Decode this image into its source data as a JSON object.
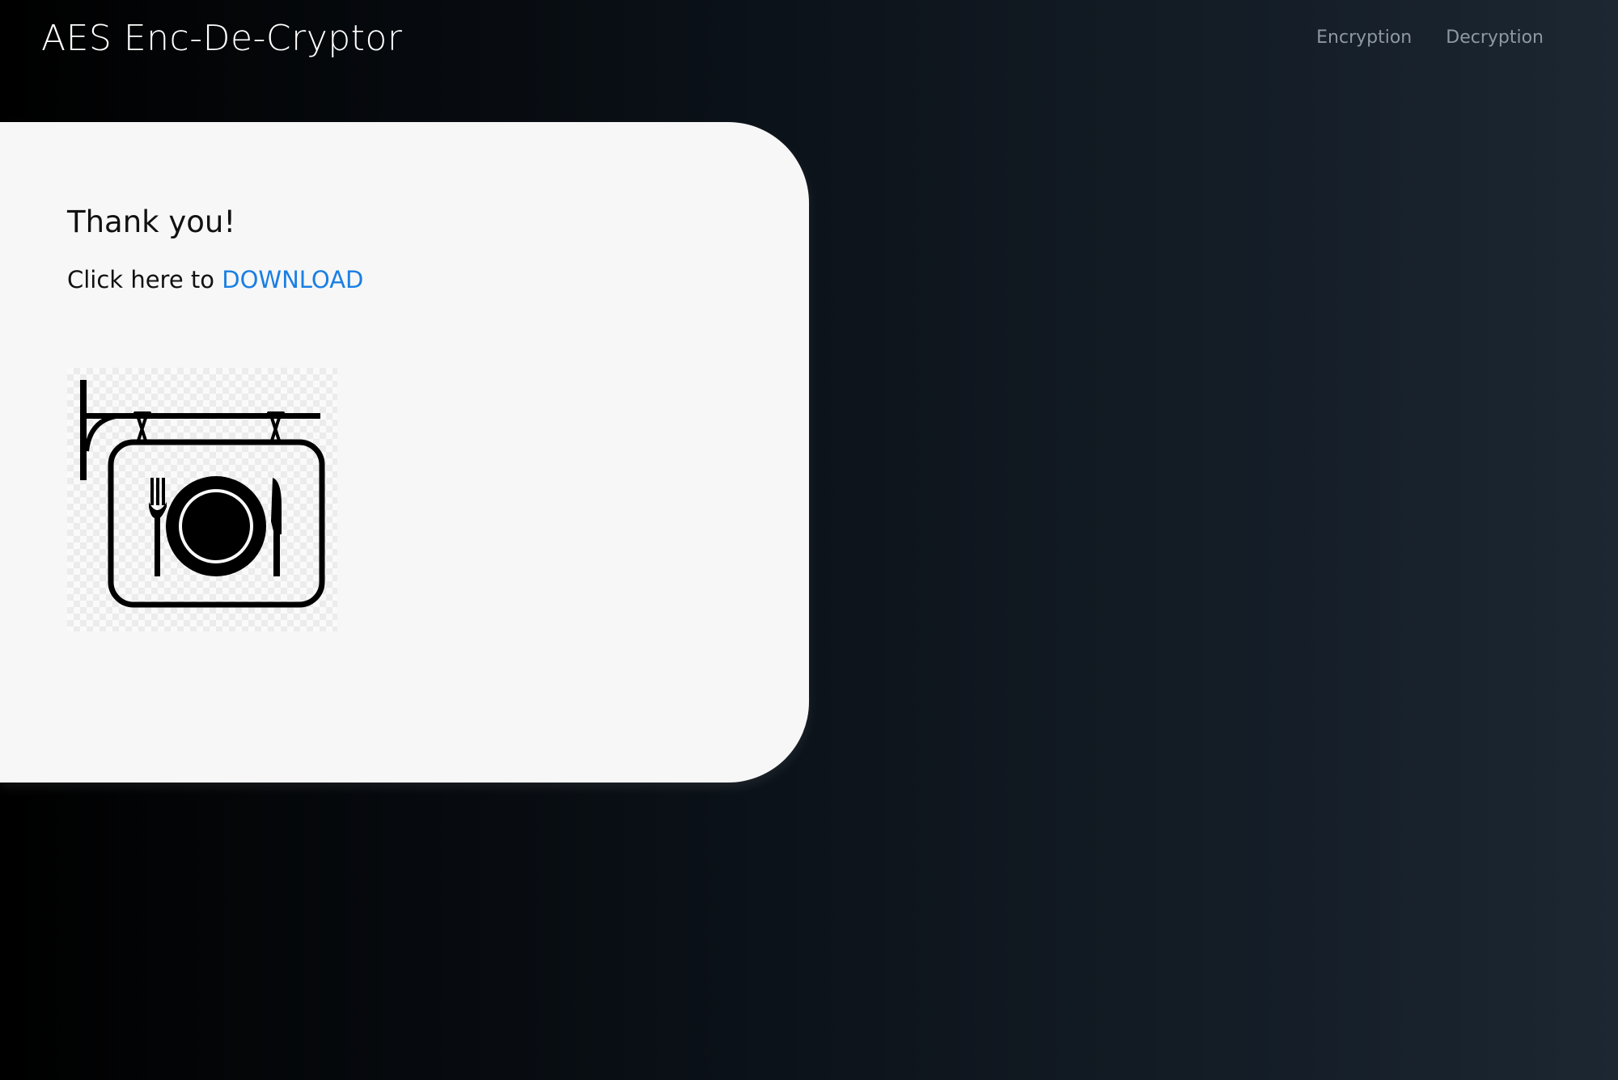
{
  "header": {
    "brand": "AES Enc-De-Cryptor",
    "nav": [
      {
        "label": "Encryption"
      },
      {
        "label": "Decryption"
      }
    ]
  },
  "main": {
    "heading": "Thank you!",
    "click_prefix": "Click here to",
    "download_label": "DOWNLOAD",
    "preview_icon": "restaurant-sign-icon"
  },
  "colors": {
    "link": "#1a7fe3",
    "card_background": "#f7f7f7",
    "nav_text": "#8f98a2"
  }
}
